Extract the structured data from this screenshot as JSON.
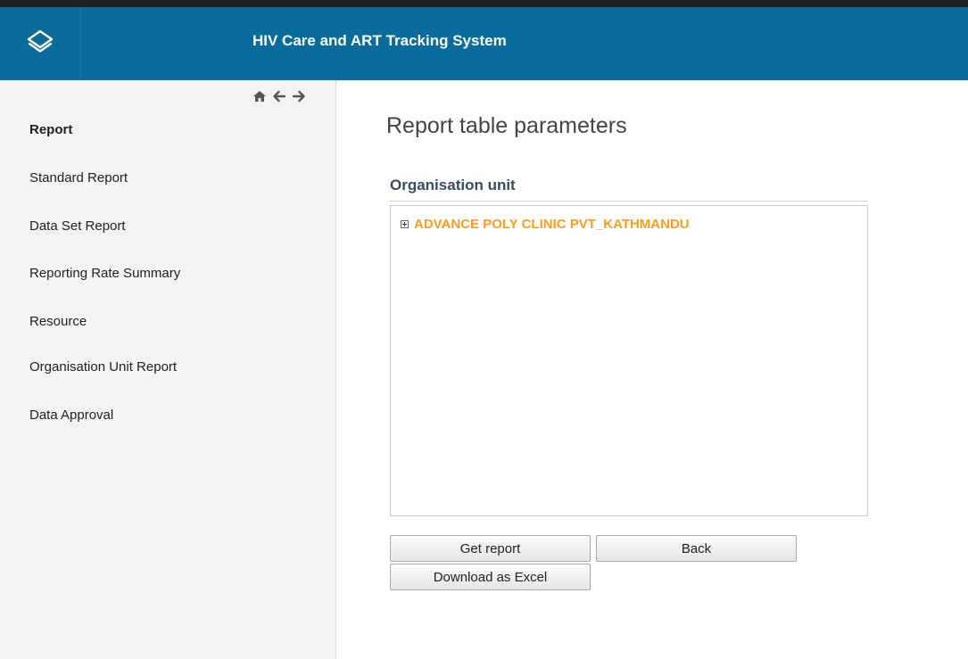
{
  "header": {
    "title": "HIV Care and ART Tracking System",
    "logo_icon": "layers-logo-icon",
    "background_color": "#0a6c9c"
  },
  "nav_icons": [
    "home-icon",
    "arrow-left-icon",
    "arrow-right-icon"
  ],
  "sidebar": {
    "heading": "Report",
    "items": [
      {
        "label": "Standard Report"
      },
      {
        "label": "Data Set Report"
      },
      {
        "label": "Reporting Rate Summary"
      },
      {
        "label": "Resource"
      },
      {
        "label": "Organisation Unit Report"
      },
      {
        "label": "Data Approval"
      }
    ]
  },
  "main": {
    "title": "Report table parameters",
    "org_unit_label": "Organisation unit",
    "tree": {
      "root_label": "ADVANCE POLY CLINIC PVT_KATHMANDU",
      "root_color": "#ff9a1e"
    },
    "buttons": {
      "get_report": "Get report",
      "back": "Back",
      "download_excel": "Download as Excel"
    }
  }
}
